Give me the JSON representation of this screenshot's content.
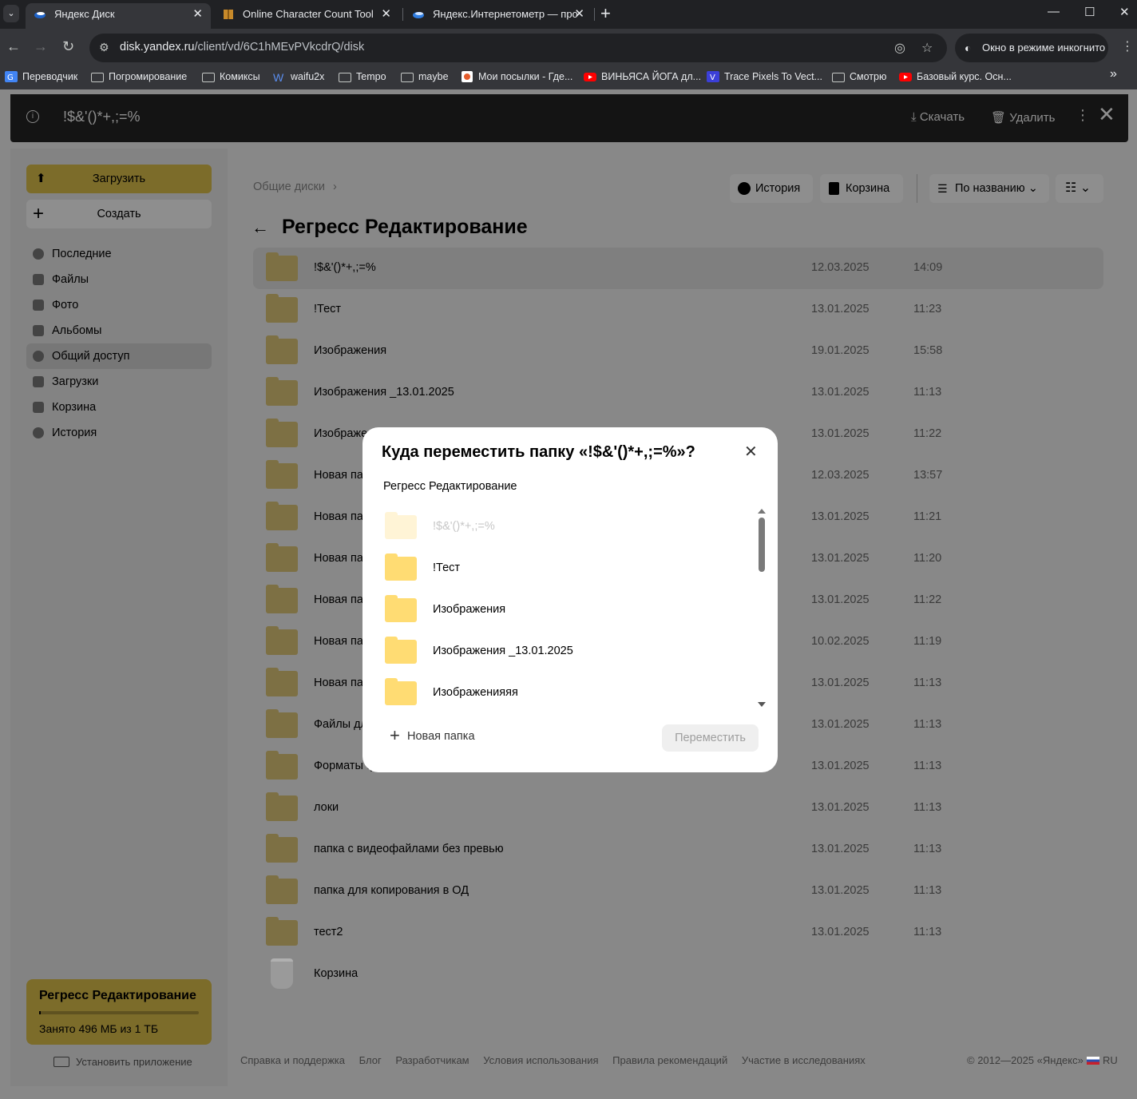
{
  "browser": {
    "tabs": [
      {
        "title": "Яндекс Диск",
        "active": true
      },
      {
        "title": "Online Character Count Tool",
        "active": false
      },
      {
        "title": "Яндекс.Интернетометр — про",
        "active": false
      }
    ],
    "url_host": "disk.yandex.ru",
    "url_path": "/client/vd/6C1hMEvPVkcdrQ/disk",
    "incognito_label": "Окно в режиме инкогнито",
    "bookmarks": [
      {
        "label": "Переводчик",
        "icon": "translate-icon"
      },
      {
        "label": "Погромирование",
        "icon": "folder-icon"
      },
      {
        "label": "Комиксы",
        "icon": "folder-icon"
      },
      {
        "label": "waifu2x",
        "icon": "w-icon"
      },
      {
        "label": "Tempo",
        "icon": "folder-icon"
      },
      {
        "label": "maybe",
        "icon": "folder-icon"
      },
      {
        "label": "Мои посылки - Где...",
        "icon": "parcel-icon"
      },
      {
        "label": "ВИНЬЯСА ЙОГА дл...",
        "icon": "youtube-icon"
      },
      {
        "label": "Trace Pixels To Vect...",
        "icon": "vector-icon"
      },
      {
        "label": "Смотрю",
        "icon": "folder-icon"
      },
      {
        "label": "Базовый курс. Осн...",
        "icon": "youtube-icon"
      }
    ]
  },
  "viewer_bar": {
    "file_name": "!$&'()*+,;=%",
    "download_label": "Скачать",
    "delete_label": "Удалить"
  },
  "sidebar": {
    "upload_label": "Загрузить",
    "create_label": "Создать",
    "nav": [
      {
        "label": "Последние",
        "icon": "clock-icon"
      },
      {
        "label": "Файлы",
        "icon": "file-icon"
      },
      {
        "label": "Фото",
        "icon": "photo-icon"
      },
      {
        "label": "Альбомы",
        "icon": "album-icon"
      },
      {
        "label": "Общий доступ",
        "icon": "shared-icon"
      },
      {
        "label": "Загрузки",
        "icon": "download-icon"
      },
      {
        "label": "Корзина",
        "icon": "trash-icon"
      },
      {
        "label": "История",
        "icon": "history-icon"
      }
    ],
    "selected_nav": "Общий доступ",
    "quota_title": "Регресс Редактирование",
    "quota_text": "Занято 496 МБ из 1 ТБ",
    "quota_used_fraction": 0.0005,
    "install_label": "Установить приложение"
  },
  "main": {
    "breadcrumb": "Общие диски",
    "history_label": "История",
    "trash_label": "Корзина",
    "sort_label": "По названию",
    "title": "Регресс Редактирование",
    "rows": [
      {
        "name": "!$&'()*+,;=%",
        "date": "12.03.2025",
        "time": "14:09"
      },
      {
        "name": "!Тест",
        "date": "13.01.2025",
        "time": "11:23"
      },
      {
        "name": "Изображения",
        "date": "19.01.2025",
        "time": "15:58"
      },
      {
        "name": "Изображения _13.01.2025",
        "date": "13.01.2025",
        "time": "11:13"
      },
      {
        "name": "Изображе",
        "date": "13.01.2025",
        "time": "11:22"
      },
      {
        "name": "Новая папка",
        "date": "12.03.2025",
        "time": "13:57"
      },
      {
        "name": "Новая папка",
        "date": "13.01.2025",
        "time": "11:21"
      },
      {
        "name": "Новая папк",
        "date": "13.01.2025",
        "time": "11:20"
      },
      {
        "name": "Новая папк",
        "date": "13.01.2025",
        "time": "11:22"
      },
      {
        "name": "Новая папк",
        "date": "10.02.2025",
        "time": "11:19"
      },
      {
        "name": "Новая папк",
        "date": "13.01.2025",
        "time": "11:13"
      },
      {
        "name": "Файлы для",
        "date": "13.01.2025",
        "time": "11:13"
      },
      {
        "name": "Форматы ф",
        "date": "13.01.2025",
        "time": "11:13"
      },
      {
        "name": "локи",
        "date": "13.01.2025",
        "time": "11:13"
      },
      {
        "name": "папка с видеофайлами без превью",
        "date": "13.01.2025",
        "time": "11:13"
      },
      {
        "name": "папка для копирования в ОД",
        "date": "13.01.2025",
        "time": "11:13"
      },
      {
        "name": "тест2",
        "date": "13.01.2025",
        "time": "11:13"
      }
    ],
    "trash_row_label": "Корзина"
  },
  "footer": {
    "links": [
      "Справка и поддержка",
      "Блог",
      "Разработчикам",
      "Условия использования",
      "Правила рекомендаций",
      "Участие в исследованиях"
    ],
    "copyright": "© 2012—2025 «Яндекс»",
    "lang": "RU"
  },
  "modal": {
    "title": "Куда переместить папку «!$&'()*+,;=%»?",
    "subtitle": "Регресс Редактирование",
    "items": [
      {
        "name": "!$&'()*+,;=%",
        "disabled": true
      },
      {
        "name": "!Тест",
        "disabled": false
      },
      {
        "name": "Изображения",
        "disabled": false
      },
      {
        "name": "Изображения _13.01.2025",
        "disabled": false
      },
      {
        "name": "Изображенияяя",
        "disabled": false
      }
    ],
    "new_folder_label": "Новая папка",
    "move_label": "Переместить"
  }
}
